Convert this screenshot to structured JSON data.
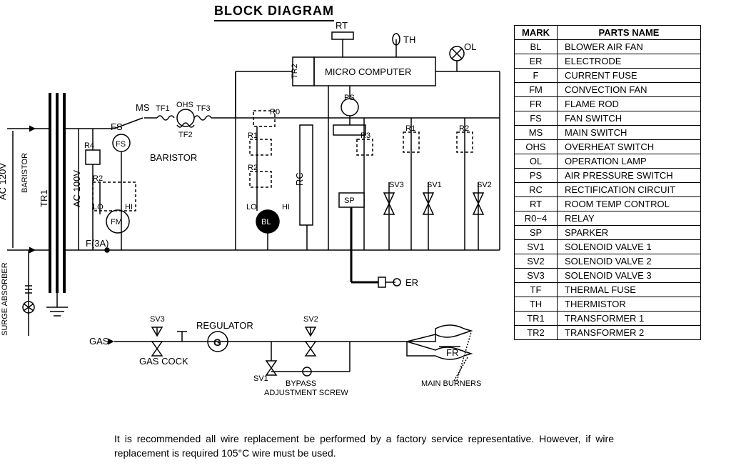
{
  "title": "BLOCK DIAGRAM",
  "parts_table": {
    "header": {
      "mark": "MARK",
      "name": "PARTS NAME"
    },
    "rows": [
      {
        "mark": "BL",
        "name": "BLOWER AIR FAN"
      },
      {
        "mark": "ER",
        "name": "ELECTRODE"
      },
      {
        "mark": "F",
        "name": "CURRENT FUSE"
      },
      {
        "mark": "FM",
        "name": "CONVECTION FAN"
      },
      {
        "mark": "FR",
        "name": "FLAME ROD"
      },
      {
        "mark": "FS",
        "name": "FAN SWITCH"
      },
      {
        "mark": "MS",
        "name": "MAIN SWITCH"
      },
      {
        "mark": "OHS",
        "name": "OVERHEAT SWITCH"
      },
      {
        "mark": "OL",
        "name": "OPERATION LAMP"
      },
      {
        "mark": "PS",
        "name": "AIR PRESSURE SWITCH"
      },
      {
        "mark": "RC",
        "name": "RECTIFICATION CIRCUIT"
      },
      {
        "mark": "RT",
        "name": "ROOM TEMP CONTROL"
      },
      {
        "mark": "R0~4",
        "name": "RELAY"
      },
      {
        "mark": "SP",
        "name": "SPARKER"
      },
      {
        "mark": "SV1",
        "name": "SOLENOID VALVE 1"
      },
      {
        "mark": "SV2",
        "name": "SOLENOID VALVE 2"
      },
      {
        "mark": "SV3",
        "name": "SOLENOID VALVE 3"
      },
      {
        "mark": "TF",
        "name": "THERMAL FUSE"
      },
      {
        "mark": "TH",
        "name": "THERMISTOR"
      },
      {
        "mark": "TR1",
        "name": "TRANSFORMER 1"
      },
      {
        "mark": "TR2",
        "name": "TRANSFORMER 2"
      }
    ]
  },
  "note": "It is recommended all wire replacement be performed by a factory service representative. However, if wire replacement is required 105°C wire must be used.",
  "labels": {
    "ac120": "AC 120V",
    "ac100": "AC 100V",
    "tr1": "TR1",
    "tr2": "TR2",
    "baristor_left": "BARISTOR",
    "baristor_mid": "BARISTOR",
    "surge": "SURGE ABSORBER",
    "ms": "MS",
    "tf1": "TF1",
    "tf2": "TF2",
    "tf3": "TF3",
    "ohs": "OHS",
    "fs": "FS",
    "r0": "R0",
    "r1": "R1",
    "r2": "R2",
    "r3": "R3",
    "r4": "R4",
    "lo": "LO",
    "hi": "HI",
    "fm": "FM",
    "bl": "BL",
    "f3a": "F(3A)",
    "rc": "RC",
    "ps": "PS",
    "sp": "SP",
    "micro": "MICRO COMPUTER",
    "rt": "RT",
    "th": "TH",
    "ol": "OL",
    "sv1": "SV1",
    "sv2": "SV2",
    "sv3": "SV3",
    "gas": "GAS",
    "gascock": "GAS COCK",
    "reg": "REGULATOR",
    "g": "G",
    "bypass1": "BYPASS",
    "bypass2": "ADJUSTMENT SCREW",
    "er": "ER",
    "fr": "FR",
    "mainburners": "MAIN BURNERS"
  }
}
